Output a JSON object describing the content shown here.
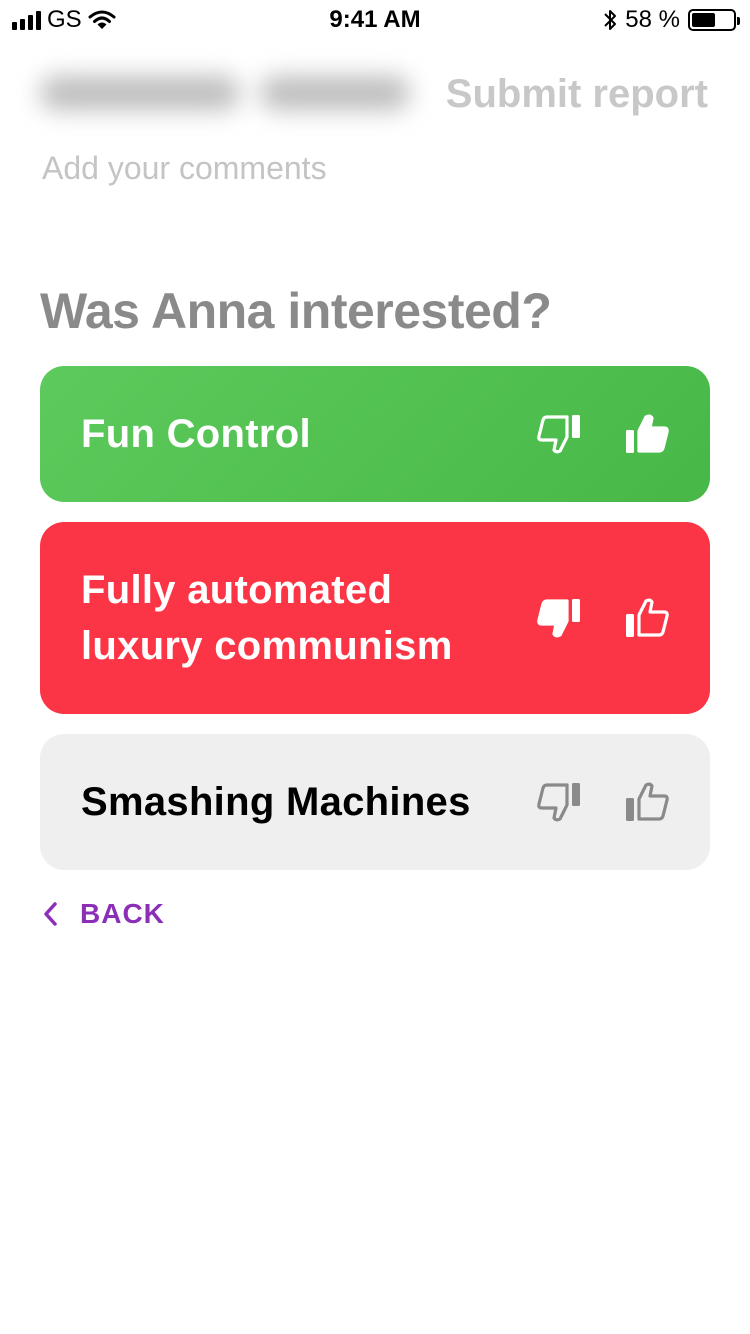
{
  "status_bar": {
    "carrier": "GS",
    "time": "9:41 AM",
    "battery_percent": "58 %",
    "battery_level": 0.58,
    "icons": [
      "signal-icon",
      "wifi-icon",
      "bluetooth-icon",
      "battery-icon"
    ]
  },
  "header": {
    "submit_label": "Submit report"
  },
  "comments": {
    "placeholder": "Add your comments",
    "value": ""
  },
  "question": "Was Anna interested?",
  "topics": [
    {
      "label": "Fun Control",
      "state": "liked",
      "color": "#52c152"
    },
    {
      "label": "Fully automated luxury communism",
      "state": "disliked",
      "color": "#fb3545"
    },
    {
      "label": "Smashing Machines",
      "state": "unrated",
      "color": "#efefef"
    }
  ],
  "back": {
    "label": "BACK",
    "color": "#8c2fb8"
  }
}
